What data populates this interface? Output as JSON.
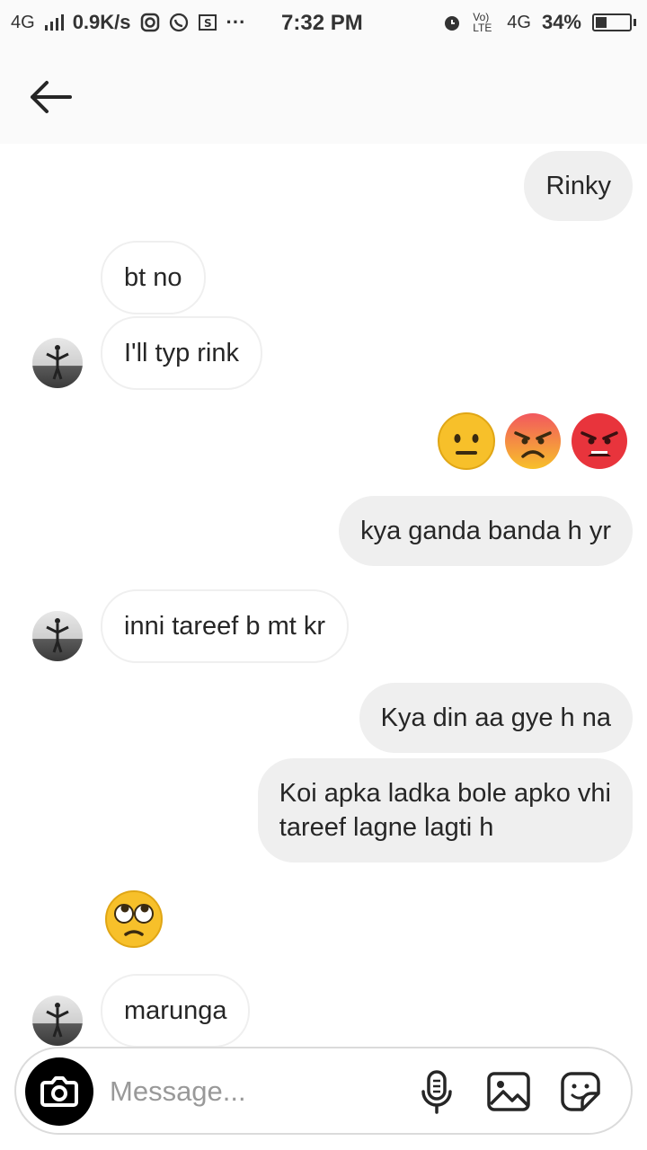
{
  "status_bar": {
    "network_left": "4G",
    "speed": "0.9K/s",
    "more": "···",
    "time": "7:32 PM",
    "volte": "Vo) LTE",
    "network_right": "4G",
    "battery": "34%",
    "battery_level": 0.34
  },
  "messages": [
    {
      "id": "m1",
      "direction": "out",
      "text": "Rinky"
    },
    {
      "id": "m2",
      "direction": "in",
      "text": "bt no"
    },
    {
      "id": "m3",
      "direction": "in",
      "text": "I'll typ rink"
    },
    {
      "id": "m4",
      "direction": "out",
      "emoji": [
        "neutral-face",
        "angry-face",
        "pouting-face"
      ]
    },
    {
      "id": "m5",
      "direction": "out",
      "text": "kya ganda banda h yr"
    },
    {
      "id": "m6",
      "direction": "in",
      "text": "inni tareef b mt kr"
    },
    {
      "id": "m7",
      "direction": "out",
      "text": "Kya din aa gye h na"
    },
    {
      "id": "m8",
      "direction": "out",
      "text": "Koi apka ladka bole apko vhi\ntareef lagne lagti h"
    },
    {
      "id": "m9",
      "direction": "in",
      "emoji": [
        "eye-roll-face"
      ]
    },
    {
      "id": "m10",
      "direction": "in",
      "text": "marunga"
    }
  ],
  "composer": {
    "placeholder": "Message..."
  },
  "colors": {
    "out_bubble": "#efefef",
    "in_border": "#efefef",
    "emoji_yellow": "#f7c02a",
    "emoji_angry": "#f2585e",
    "emoji_red": "#e8343c"
  }
}
